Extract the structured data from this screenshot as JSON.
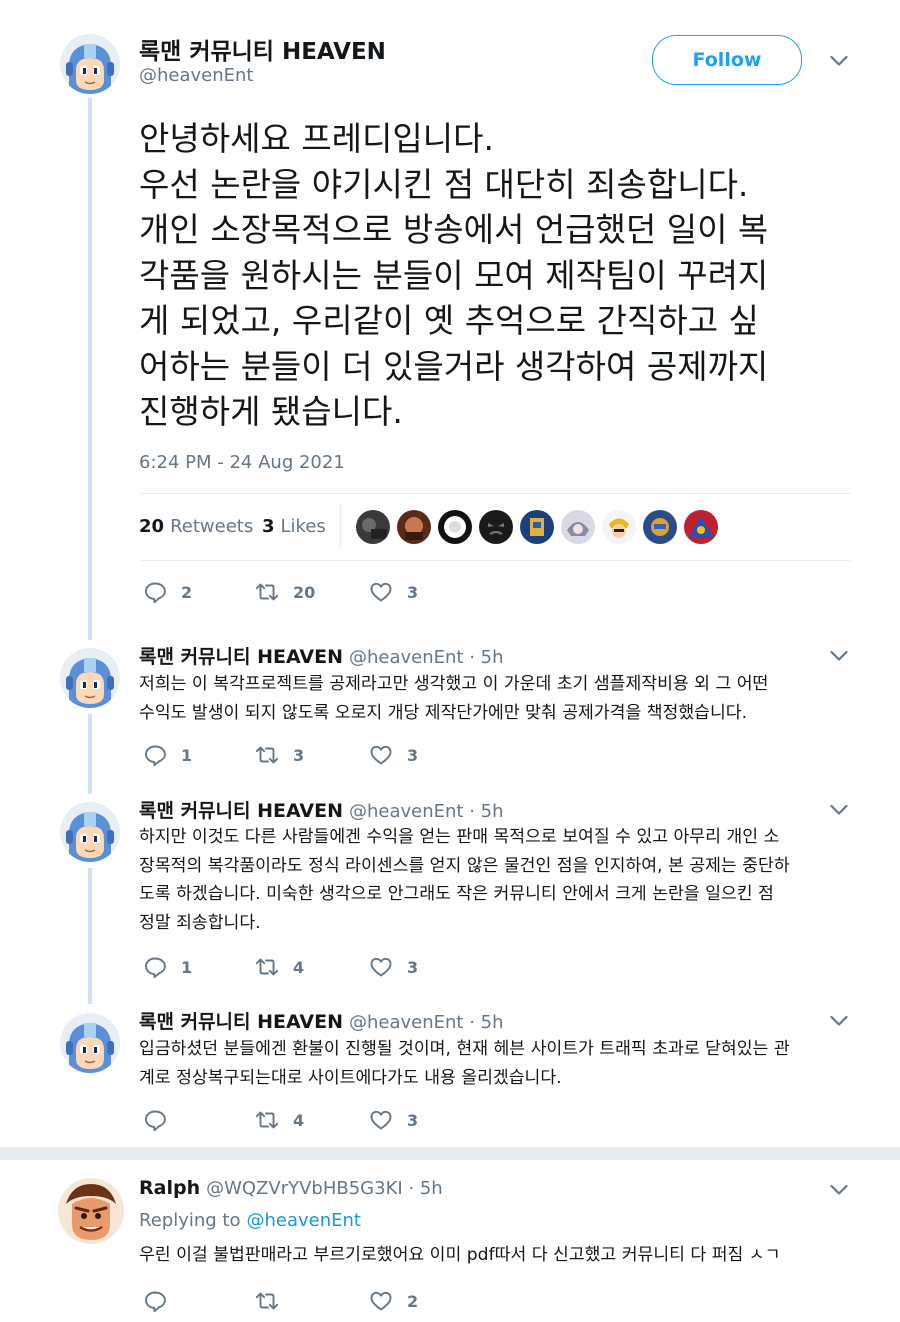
{
  "main_tweet": {
    "author_name": "록맨 커뮤니티 HEAVEN",
    "author_handle": "@heavenEnt",
    "follow_label": "Follow",
    "text_lines": [
      "안녕하세요 프레디입니다.",
      "우선 논란을 야기시킨 점 대단히 죄송합니다.",
      "개인 소장목적으로 방송에서 언급했던 일이 복",
      "각품을 원하시는 분들이 모여 제작팀이 꾸려지",
      "게 되었고, 우리같이 옛 추억으로 간직하고 싶",
      "어하는 분들이 더 있을거라 생각하여 공제까지",
      "진행하게 됐습니다."
    ],
    "timestamp": "6:24 PM - 24 Aug 2021",
    "retweets_count": "20",
    "retweets_label": "Retweets",
    "likes_count": "3",
    "likes_label": "Likes",
    "actions": {
      "replies": "2",
      "retweets": "20",
      "likes": "3"
    }
  },
  "replies": [
    {
      "author_name": "록맨 커뮤니티 HEAVEN",
      "author_handle": "@heavenEnt · 5h",
      "text_lines": [
        "저희는 이 복각프로젝트를 공제라고만 생각했고 이 가운데 초기 샘플제작비용 외 그 어떤",
        "수익도 발생이 되지 않도록 오로지 개당 제작단가에만 맞춰 공제가격을 책정했습니다."
      ],
      "actions": {
        "replies": "1",
        "retweets": "3",
        "likes": "3"
      }
    },
    {
      "author_name": "록맨 커뮤니티 HEAVEN",
      "author_handle": "@heavenEnt · 5h",
      "text_lines": [
        "하지만 이것도 다른 사람들에겐 수익을 얻는 판매 목적으로 보여질 수 있고 아무리 개인 소",
        "장목적의 복각품이라도 정식 라이센스를 얻지 않은 물건인 점을 인지하여, 본 공제는 중단하",
        "도록 하겠습니다. 미숙한 생각으로 안그래도 작은 커뮤니티 안에서 크게 논란을 일으킨 점",
        "정말 죄송합니다."
      ],
      "actions": {
        "replies": "1",
        "retweets": "4",
        "likes": "3"
      }
    },
    {
      "author_name": "록맨 커뮤니티 HEAVEN",
      "author_handle": "@heavenEnt · 5h",
      "text_lines": [
        "입금하셨던 분들에겐 환불이 진행될 것이며, 현재 헤븐 사이트가 트래픽 초과로 닫혀있는 관",
        "계로 정상복구되는대로 사이트에다가도 내용 올리겠습니다."
      ],
      "actions": {
        "replies": "",
        "retweets": "4",
        "likes": "3"
      }
    },
    {
      "author_name": "Ralph",
      "author_handle": "@WQZVrYVbHB5G3KI · 5h",
      "replying_prefix": "Replying to",
      "replying_handle": "@heavenEnt",
      "text_lines": [
        "우린 이걸 불법판매라고 부르기로했어요 이미 pdf따서 다 신고했고 커뮤니티 다 퍼짐 ㅅㄱ"
      ],
      "actions": {
        "replies": "",
        "retweets": "",
        "likes": "2"
      }
    }
  ],
  "icons": {
    "reply": "reply-icon",
    "retweet": "retweet-icon",
    "like": "heart-icon",
    "more": "chevron-down-icon"
  },
  "colors": {
    "accent": "#1da1f2",
    "text": "#14171a",
    "secondary": "#657786",
    "thread_line": "#cfe3f4",
    "divider": "#e6ecf0"
  }
}
